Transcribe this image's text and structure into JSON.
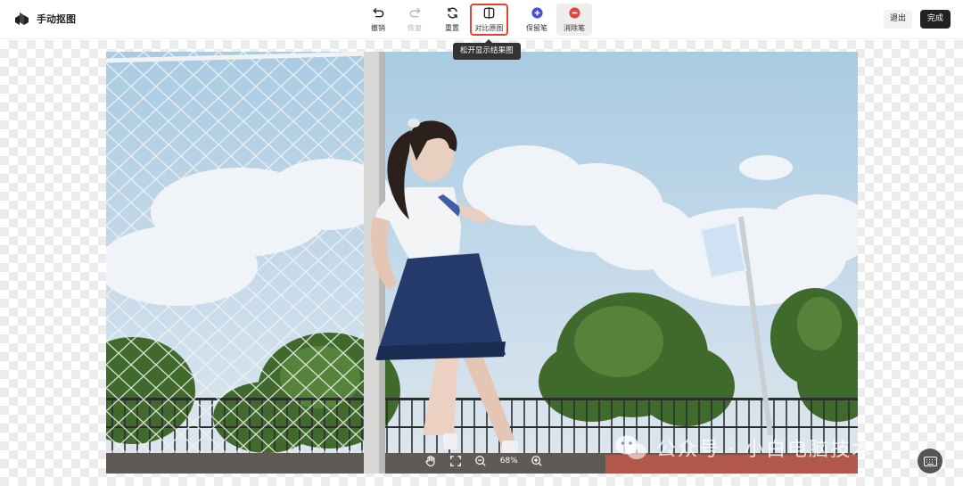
{
  "app": {
    "title": "手动抠图"
  },
  "toolbar": {
    "undo": "撤销",
    "redo": "恢复",
    "reset": "重置",
    "compare": "对比原图",
    "keep_brush": "保留笔",
    "erase_brush": "消除笔"
  },
  "tooltip": {
    "compare_hint": "松开显示结果图"
  },
  "actions": {
    "exit": "退出",
    "done": "完成"
  },
  "zoom": {
    "level": "68%"
  },
  "watermark": {
    "text": "公众号 · 小白电脑技术"
  },
  "colors": {
    "highlight_border": "#e0432f",
    "keep_brush": "#4a4ee8",
    "erase_brush": "#e2463b",
    "done_button": "#222222"
  },
  "icons": [
    "undo-icon",
    "redo-icon",
    "reset-icon",
    "compare-icon",
    "plus-circle-icon",
    "minus-circle-icon",
    "hand-icon",
    "fullscreen-icon",
    "zoom-out-icon",
    "zoom-in-icon",
    "keyboard-icon",
    "wechat-icon"
  ]
}
